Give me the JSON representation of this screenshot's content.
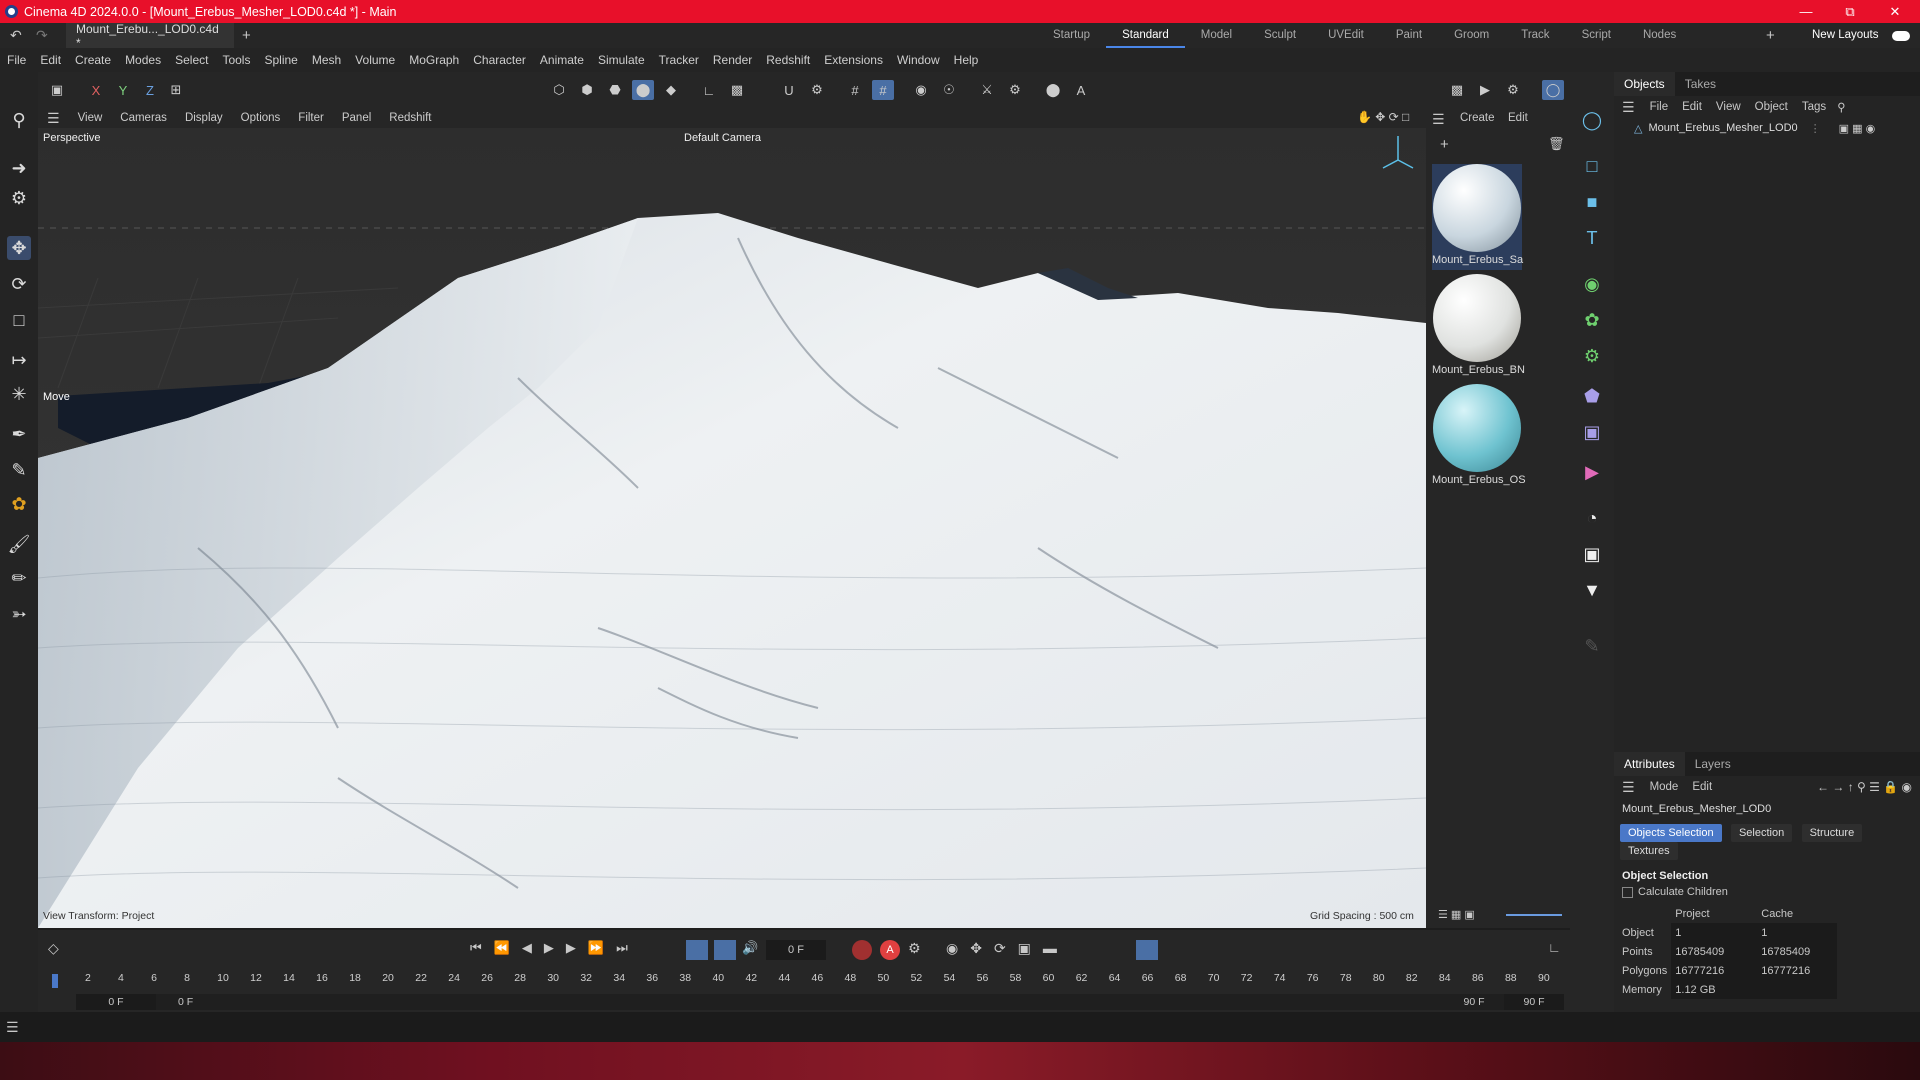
{
  "window": {
    "title": "Cinema 4D 2024.0.0 - [Mount_Erebus_Mesher_LOD0.c4d *] - Main",
    "accent": "#e8102a"
  },
  "doc_tab": {
    "label": "Mount_Erebu..._LOD0.c4d *"
  },
  "layouts": [
    "Startup",
    "Standard",
    "Model",
    "Sculpt",
    "UVEdit",
    "Paint",
    "Groom",
    "Track",
    "Script",
    "Nodes"
  ],
  "new_layouts": "New Layouts",
  "menu": [
    "File",
    "Edit",
    "Create",
    "Modes",
    "Select",
    "Tools",
    "Spline",
    "Mesh",
    "Volume",
    "MoGraph",
    "Character",
    "Animate",
    "Simulate",
    "Tracker",
    "Render",
    "Redshift",
    "Extensions",
    "Window",
    "Help"
  ],
  "axes": [
    "X",
    "Y",
    "Z"
  ],
  "viewport_menu": [
    "View",
    "Cameras",
    "Display",
    "Options",
    "Filter",
    "Panel",
    "Redshift"
  ],
  "viewport": {
    "projection": "Perspective",
    "camera": "Default Camera",
    "tool": "Move",
    "transform": "View Transform: Project",
    "grid": "Grid Spacing : 500 cm"
  },
  "materials_menu": [
    "Create",
    "Edit"
  ],
  "materials": [
    {
      "name": "Mount_Erebus_Sa",
      "color": "#c9d6df"
    },
    {
      "name": "Mount_Erebus_BN",
      "color": "#e0e2e0"
    },
    {
      "name": "Mount_Erebus_OS",
      "color": "#6fc3d0"
    }
  ],
  "objects_panel": {
    "tabs": [
      "Objects",
      "Takes"
    ],
    "menu": [
      "File",
      "Edit",
      "View",
      "Object",
      "Tags"
    ],
    "items": [
      "Mount_Erebus_Mesher_LOD0"
    ]
  },
  "attributes": {
    "tabs": [
      "Attributes",
      "Layers"
    ],
    "menu": [
      "Mode",
      "Edit"
    ],
    "object_name": "Mount_Erebus_Mesher_LOD0",
    "subtabs": [
      "Objects Selection",
      "Selection",
      "Structure",
      "Textures"
    ],
    "section": "Object Selection",
    "checkbox": "Calculate Children",
    "col_project": "Project",
    "col_cache": "Cache",
    "rows": [
      {
        "label": "Object",
        "project": "1",
        "cache": "1"
      },
      {
        "label": "Points",
        "project": "16785409",
        "cache": "16785409"
      },
      {
        "label": "Polygons",
        "project": "16777216",
        "cache": "16777216"
      },
      {
        "label": "Memory",
        "project": "1.12 GB",
        "cache": ""
      }
    ]
  },
  "timeline": {
    "current_frame": "0 F",
    "frames": [
      "0",
      "2",
      "4",
      "6",
      "8",
      "10",
      "12",
      "14",
      "16",
      "18",
      "20",
      "22",
      "24",
      "26",
      "28",
      "30",
      "32",
      "34",
      "36",
      "38",
      "40",
      "42",
      "44",
      "46",
      "48",
      "50",
      "52",
      "54",
      "56",
      "58",
      "60",
      "62",
      "64",
      "66",
      "68",
      "70",
      "72",
      "74",
      "76",
      "78",
      "80",
      "82",
      "84",
      "86",
      "88",
      "90"
    ],
    "start": "0 F",
    "start2": "0 F",
    "end": "90 F",
    "end2": "90 F"
  }
}
